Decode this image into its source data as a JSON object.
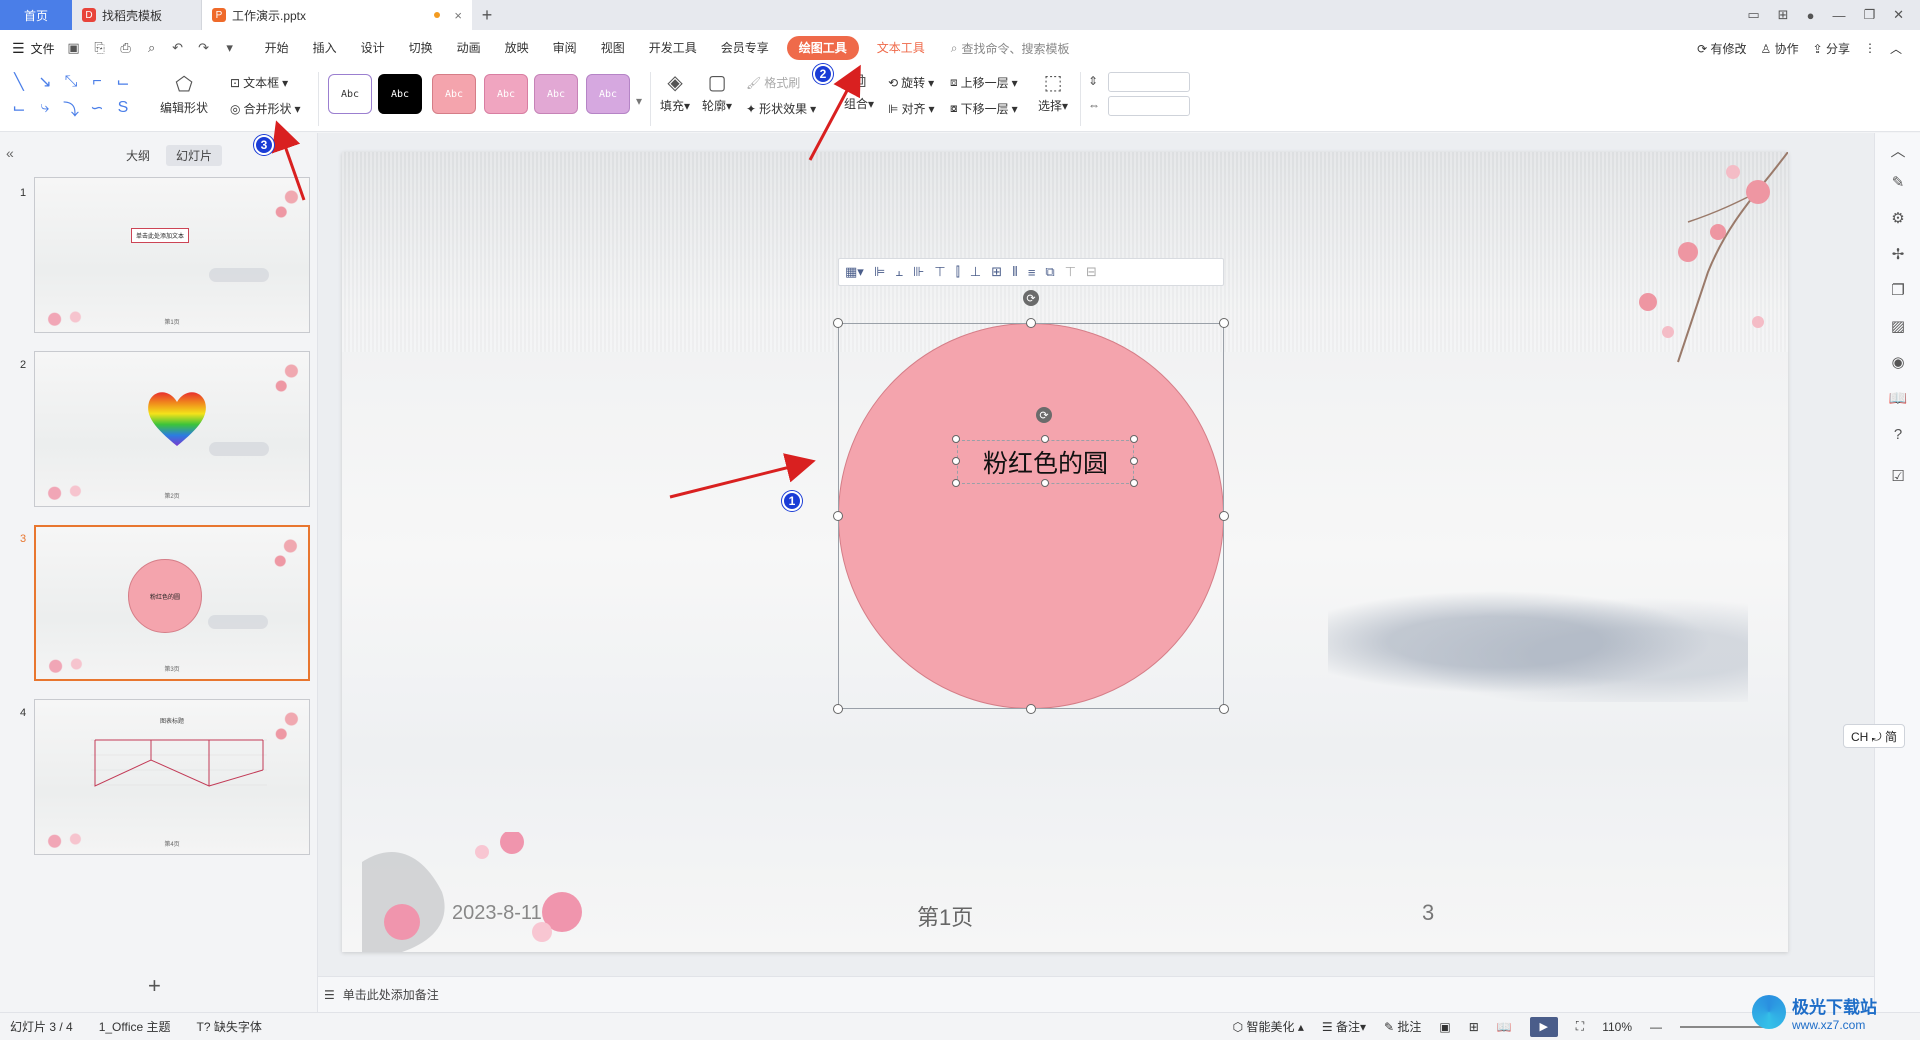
{
  "tabs": [
    {
      "label": "首页"
    },
    {
      "label": "找稻壳模板"
    },
    {
      "label": "工作演示.pptx"
    }
  ],
  "menu": {
    "file": "文件",
    "tabs": [
      "开始",
      "插入",
      "设计",
      "切换",
      "动画",
      "放映",
      "审阅",
      "视图",
      "开发工具",
      "会员专享"
    ],
    "active_tab": "绘图工具",
    "text_tool": "文本工具",
    "search": "查找命令、搜索模板",
    "right": [
      "有修改",
      "协作",
      "分享"
    ]
  },
  "ribbon": {
    "edit_shape": "编辑形状",
    "text_box": "文本框",
    "merge_shape": "合并形状",
    "style_label": "Abc",
    "styles": [
      {
        "bg": "#ffffff",
        "border": "#9b7fd0",
        "fg": "#333"
      },
      {
        "bg": "#000000",
        "border": "#000000",
        "fg": "#fff"
      },
      {
        "bg": "#f4a4ad",
        "border": "#d57d87",
        "fg": "#fff"
      },
      {
        "bg": "#f0a5c0",
        "border": "#d87ea2",
        "fg": "#fff"
      },
      {
        "bg": "#e2a8d4",
        "border": "#c683b7",
        "fg": "#fff"
      },
      {
        "bg": "#d6a8e0",
        "border": "#b584c6",
        "fg": "#fff"
      }
    ],
    "fill": "填充",
    "outline": "轮廓",
    "format_painter": "格式刷",
    "shape_effects": "形状效果",
    "group": "组合",
    "align": "对齐",
    "rotate": "旋转",
    "bring_forward": "上移一层",
    "send_backward": "下移一层",
    "select": "选择"
  },
  "left_panel": {
    "tab_outline": "大纲",
    "tab_slides": "幻灯片",
    "slides": [
      {
        "num": "1",
        "title_text": "单击此处添加文本",
        "page": "第1页"
      },
      {
        "num": "2",
        "page": "第2页"
      },
      {
        "num": "3",
        "text": "粉红色的圆",
        "page": "第3页"
      },
      {
        "num": "4",
        "chart_title": "图表标题",
        "page": "第4页"
      }
    ]
  },
  "slide": {
    "circle_text": "粉红色的圆",
    "circle_color": "#f4a4ad",
    "date": "2023-8-11",
    "page_label": "第1页",
    "number": "3"
  },
  "annotations": [
    "1",
    "2",
    "3"
  ],
  "notes_placeholder": "单击此处添加备注",
  "ime": "CH ⤾ 简",
  "status": {
    "slide_counter": "幻灯片 3 / 4",
    "theme": "1_Office 主题",
    "missing_font": "缺失字体",
    "smart_beautify": "智能美化",
    "notes": "备注",
    "comments": "批注",
    "zoom": "110%"
  },
  "watermark": {
    "cn": "极光下载站",
    "url": "www.xz7.com"
  }
}
